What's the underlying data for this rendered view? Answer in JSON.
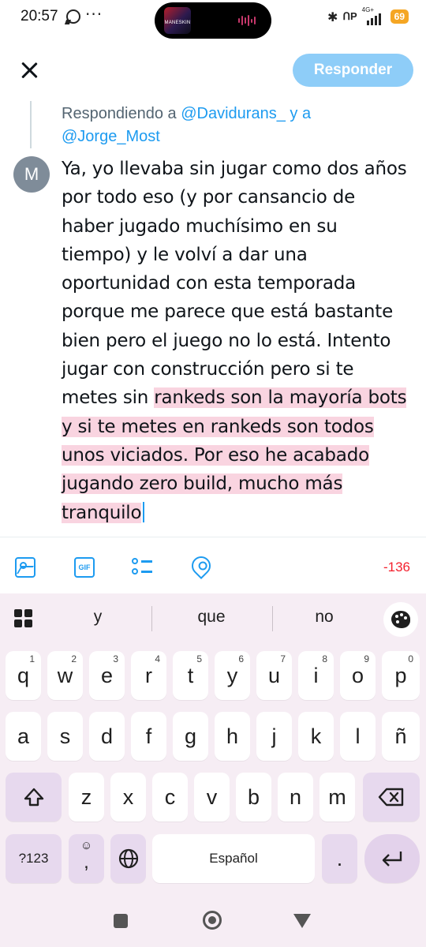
{
  "status_bar": {
    "time": "20:57",
    "more": "···",
    "island_art_label": "MANESKIN",
    "network": "4G+",
    "battery": "69"
  },
  "header": {
    "reply_button": "Responder"
  },
  "compose": {
    "replying_prefix": "Respondiendo a ",
    "mention_1": "@Davidurans_",
    "connector": " y a",
    "mention_2": "@Jorge_Most",
    "avatar_letter": "M",
    "lines": [
      "Ya, yo llevaba sin jugar como dos años",
      "por todo eso (y por cansancio de",
      "haber jugado muchísimo en su",
      "tiempo) y le volví a dar una",
      "oportunidad con esta temporada",
      "porque me parece que está bastante",
      "bien pero el juego no lo está. Intento",
      "jugar con construcción pero si te"
    ],
    "line9_normal": "metes sin ",
    "line9_over": "rankeds son la mayoría bots",
    "over_lines": [
      "y si te metes en rankeds son todos",
      "unos viciados. Por eso he acabado",
      "jugando zero build, mucho más",
      "tranquilo"
    ],
    "char_counter": "-136",
    "toolbar": {
      "gif_label": "GIF"
    },
    "colors": {
      "accent": "#1d9bf0",
      "accent_disabled": "#8ecdf8",
      "overflow_highlight": "#f9d4e0",
      "counter_red": "#f4212e"
    }
  },
  "keyboard": {
    "suggestions": [
      "y",
      "que",
      "no"
    ],
    "row1": [
      {
        "key": "q",
        "num": "1"
      },
      {
        "key": "w",
        "num": "2"
      },
      {
        "key": "e",
        "num": "3"
      },
      {
        "key": "r",
        "num": "4"
      },
      {
        "key": "t",
        "num": "5"
      },
      {
        "key": "y",
        "num": "6"
      },
      {
        "key": "u",
        "num": "7"
      },
      {
        "key": "i",
        "num": "8"
      },
      {
        "key": "o",
        "num": "9"
      },
      {
        "key": "p",
        "num": "0"
      }
    ],
    "row2": [
      "a",
      "s",
      "d",
      "f",
      "g",
      "h",
      "j",
      "k",
      "l",
      "ñ"
    ],
    "row3": [
      "z",
      "x",
      "c",
      "v",
      "b",
      "n",
      "m"
    ],
    "symbols_key": "?123",
    "emoji_key": "☺",
    "comma_key": ",",
    "space_label": "Español",
    "period_key": ".",
    "shift_icon": "shift-icon",
    "backspace_icon": "backspace-icon",
    "enter_icon": "enter-icon",
    "globe_icon": "globe-icon"
  }
}
